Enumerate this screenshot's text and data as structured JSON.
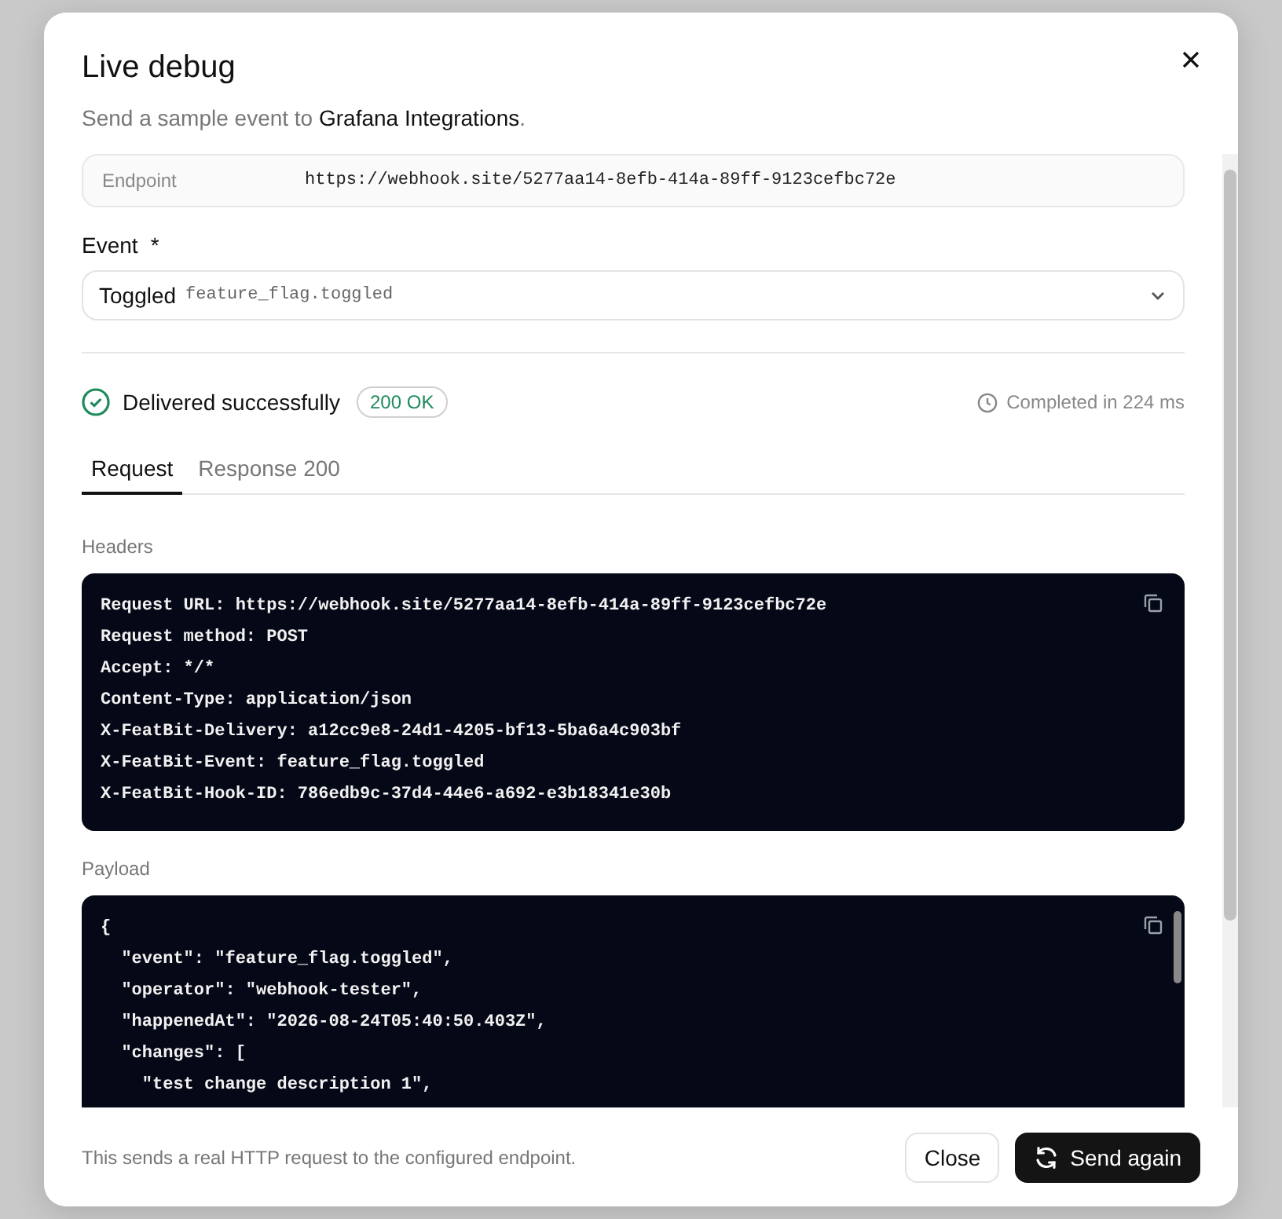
{
  "dialog": {
    "title": "Live debug",
    "subtitle_prefix": "Send a sample event to ",
    "subtitle_target": "Grafana Integrations",
    "subtitle_suffix": "."
  },
  "endpoint": {
    "label": "Endpoint",
    "value": "https://webhook.site/5277aa14-8efb-414a-89ff-9123cefbc72e"
  },
  "event": {
    "label": "Event",
    "required_mark": "*",
    "value": "Toggled",
    "code": "feature_flag.toggled"
  },
  "status": {
    "kind": "success",
    "text": "Delivered successfully",
    "badge": "200 OK",
    "duration": "Completed in 224 ms"
  },
  "tabs": [
    {
      "label": "Request",
      "selected": true
    },
    {
      "label": "Response 200",
      "selected": false
    }
  ],
  "sections": [
    {
      "title": "Headers",
      "lines": [
        "Request URL: https://webhook.site/5277aa14-8efb-414a-89ff-9123cefbc72e",
        "Request method: POST",
        "Accept: */*",
        "Content-Type: application/json",
        "X-FeatBit-Delivery: a12cc9e8-24d1-4205-bf13-5ba6a4c903bf",
        "X-FeatBit-Event: feature_flag.toggled",
        "X-FeatBit-Hook-ID: 786edb9c-37d4-44e6-a692-e3b18341e30b"
      ]
    },
    {
      "title": "Payload",
      "scrollable": true,
      "lines": [
        "{",
        "  \"event\": \"feature_flag.toggled\",",
        "  \"operator\": \"webhook-tester\",",
        "  \"happenedAt\": \"2026-08-24T05:40:50.403Z\",",
        "  \"changes\": [",
        "    \"test change description 1\","
      ]
    }
  ],
  "footer": {
    "note": "This sends a real HTTP request to the configured endpoint.",
    "buttons": [
      {
        "label": "Close",
        "kind": "secondary"
      },
      {
        "label": "Send again",
        "kind": "primary"
      }
    ]
  }
}
